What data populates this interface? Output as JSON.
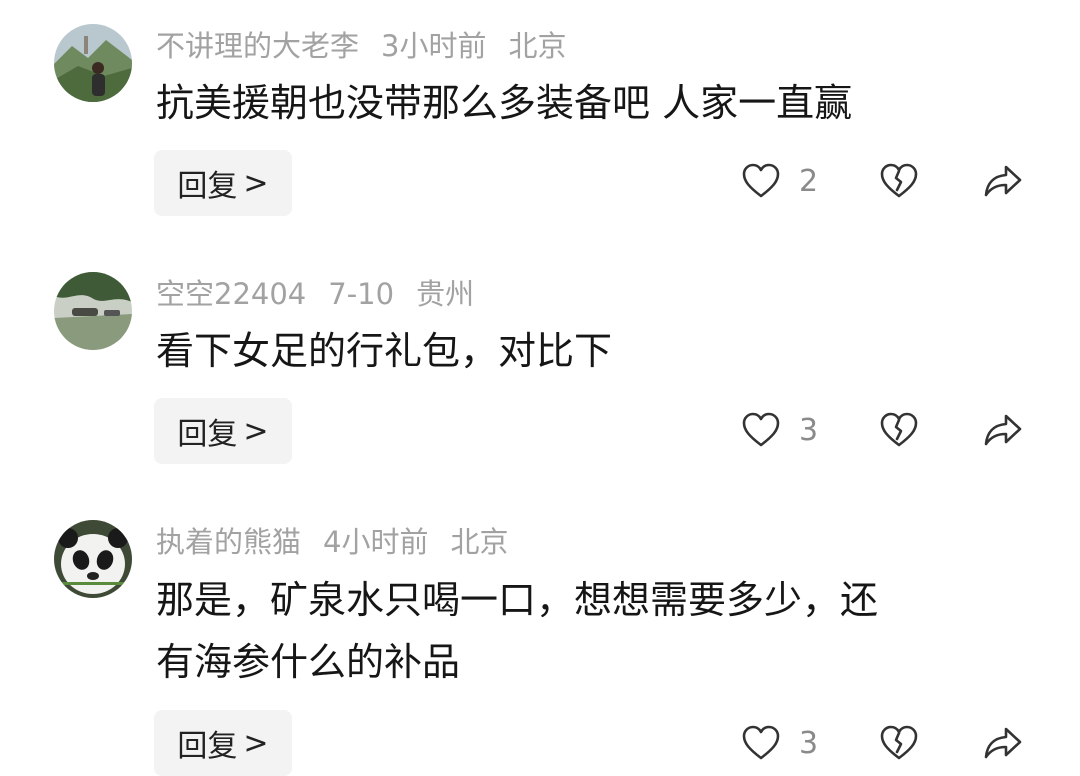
{
  "comments": [
    {
      "author": "不讲理的大老李",
      "time": "3小时前",
      "location": "北京",
      "lines": [
        "抗美援朝也没带那么多装备吧 人家一直赢"
      ],
      "likes": "2"
    },
    {
      "author": "空空22404",
      "time": "7-10",
      "location": "贵州",
      "lines": [
        "看下女足的行礼包，对比下"
      ],
      "likes": "3"
    },
    {
      "author": "执着的熊猫",
      "time": "4小时前",
      "location": "北京",
      "lines": [
        "那是，矿泉水只喝一口，想想需要多少，还",
        "有海参什么的补品"
      ],
      "likes": "3"
    }
  ],
  "reply_label": "回复",
  "reply_chevron": ">",
  "icons": {
    "like": "heart-outline-icon",
    "dislike": "broken-heart-icon",
    "share": "share-arrow-icon"
  }
}
